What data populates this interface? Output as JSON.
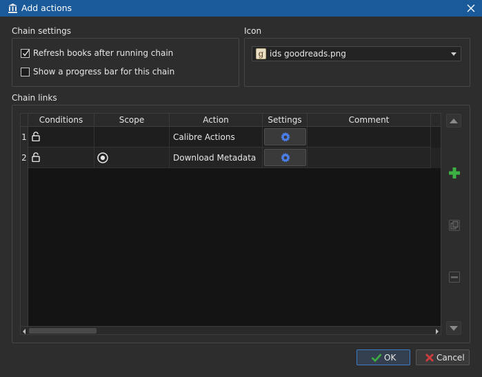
{
  "window": {
    "title": "Add actions"
  },
  "chain_settings": {
    "label": "Chain settings",
    "refresh_books": {
      "label": "Refresh books after running chain",
      "checked": true
    },
    "progress_bar": {
      "label": "Show a progress bar for this chain",
      "checked": false
    }
  },
  "icon_section": {
    "label": "Icon",
    "selected": "ids goodreads.png",
    "icon_glyph": "g"
  },
  "chain_links": {
    "label": "Chain links",
    "columns": [
      "Conditions",
      "Scope",
      "Action",
      "Settings",
      "Comment"
    ],
    "rows": [
      {
        "number": "1",
        "condition_icon": "unlock-icon",
        "scope_icon": "",
        "action": "Calibre Actions",
        "settings_icon": "gear-icon",
        "comment": ""
      },
      {
        "number": "2",
        "condition_icon": "unlock-icon",
        "scope_icon": "target-icon",
        "action": "Download Metadata",
        "settings_icon": "gear-icon",
        "comment": ""
      }
    ]
  },
  "side_buttons": [
    "move-up-icon",
    "add-icon",
    "copy-icon",
    "remove-icon",
    "move-down-icon"
  ],
  "footer": {
    "ok_label": "OK",
    "cancel_label": "Cancel"
  },
  "colors": {
    "titlebar": "#1a5a9a",
    "accent_green": "#3cb043",
    "cancel_red": "#d23b3b",
    "gear_blue": "#4a7ee8"
  }
}
